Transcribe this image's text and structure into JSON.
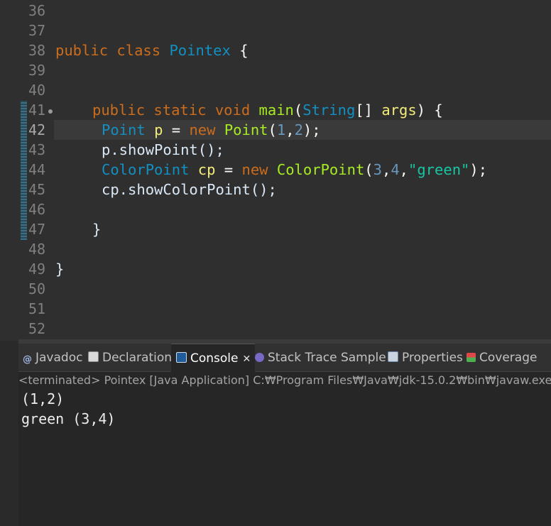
{
  "editor": {
    "line_numbers": [
      "36",
      "37",
      "38",
      "39",
      "40",
      "41",
      "42",
      "43",
      "44",
      "45",
      "46",
      "47",
      "48",
      "49",
      "50",
      "51",
      "52"
    ],
    "lines": {
      "l38": {
        "kw1": "public",
        "kw2": "class",
        "cls": "Pointex",
        "brace": "{"
      },
      "l41": {
        "kw1": "public",
        "kw2": "static",
        "kw3": "void",
        "mth": "main",
        "p1": "(",
        "cls": "String",
        "p2": "[] ",
        "var": "args",
        "p3": ") {"
      },
      "l42": {
        "cls1": "Point",
        "var": "p",
        "eq": " = ",
        "kw": "new",
        "cls2": "Point",
        "p1": "(",
        "n1": "1",
        "c": ",",
        "n2": "2",
        "p2": ");"
      },
      "l43": {
        "text": "p.showPoint();"
      },
      "l44": {
        "cls1": "ColorPoint",
        "var": "cp",
        "eq": " = ",
        "kw": "new",
        "cls2": "ColorPoint",
        "p1": "(",
        "n1": "3",
        "c1": ",",
        "n2": "4",
        "c2": ",",
        "str": "\"green\"",
        "p2": ");"
      },
      "l45": {
        "text": "cp.showColorPoint();"
      },
      "l47": {
        "text": "}"
      },
      "l49": {
        "text": "}"
      }
    }
  },
  "console_panel": {
    "tabs": {
      "javadoc": "Javadoc",
      "declaration": "Declaration",
      "console": "Console",
      "stack_trace": "Stack Trace Sample",
      "properties": "Properties",
      "coverage": "Coverage"
    },
    "close_glyph": "✕",
    "status": "<terminated> Pointex [Java Application] C:₩Program Files₩Java₩jdk-15.0.2₩bin₩javaw.exe (",
    "output": [
      "(1,2)",
      "green (3,4)"
    ]
  },
  "colors": {
    "keyword": "#cc6c1d",
    "class": "#1290c3",
    "method": "#a7ec21",
    "variable": "#f3ec79",
    "string": "#17c6a3",
    "background": "#2f2f2f"
  }
}
